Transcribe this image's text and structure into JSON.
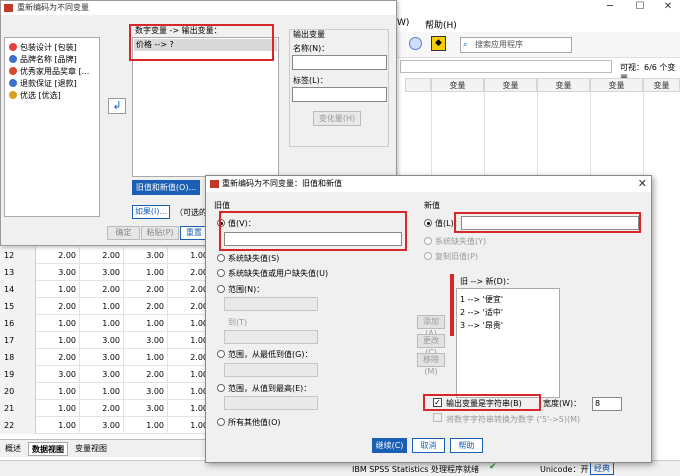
{
  "bg": {
    "menu": [
      "W)",
      "帮助(H)"
    ],
    "search_placeholder": "搜索应用程序",
    "visible": "可视：6/6 个变量",
    "col_header": "变量",
    "rows": [
      {
        "n": "12",
        "c": [
          "2.00",
          "2.00",
          "3.00",
          "1.00"
        ]
      },
      {
        "n": "13",
        "c": [
          "3.00",
          "3.00",
          "1.00",
          "2.00"
        ]
      },
      {
        "n": "14",
        "c": [
          "1.00",
          "2.00",
          "2.00",
          "2.00"
        ]
      },
      {
        "n": "15",
        "c": [
          "2.00",
          "1.00",
          "2.00",
          "2.00"
        ]
      },
      {
        "n": "16",
        "c": [
          "1.00",
          "1.00",
          "1.00",
          "1.00"
        ]
      },
      {
        "n": "17",
        "c": [
          "1.00",
          "3.00",
          "3.00",
          "1.00"
        ]
      },
      {
        "n": "18",
        "c": [
          "2.00",
          "3.00",
          "1.00",
          "2.00"
        ]
      },
      {
        "n": "19",
        "c": [
          "3.00",
          "3.00",
          "2.00",
          "1.00"
        ]
      },
      {
        "n": "20",
        "c": [
          "1.00",
          "1.00",
          "3.00",
          "1.00"
        ]
      },
      {
        "n": "21",
        "c": [
          "1.00",
          "2.00",
          "3.00",
          "1.00"
        ]
      },
      {
        "n": "22",
        "c": [
          "1.00",
          "3.00",
          "1.00",
          "1.00"
        ]
      }
    ],
    "tabs": [
      "概述",
      "数据视图",
      "变量视图"
    ],
    "status_center": "IBM SPSS Statistics 处理程序就绪",
    "status_right": "Unicode：开",
    "status_mode": "经典"
  },
  "dlg1": {
    "title": "重新编码为不同变量",
    "vars": [
      {
        "label": "包装设计 [包装]",
        "color": "#e04040"
      },
      {
        "label": "品牌名称 [品牌]",
        "color": "#3b6fd1"
      },
      {
        "label": "优秀家用品奖章 [...",
        "color": "#d94a2f"
      },
      {
        "label": "退款保证 [退款]",
        "color": "#3b6fd1"
      },
      {
        "label": "优选 [优选]",
        "color": "#d9a020"
      }
    ],
    "numvar_label": "数字变量 -> 输出变量：",
    "numvar_item": "价格 --> ?",
    "out_group": "输出变量",
    "name_label": "名称(N)：",
    "label_label": "标签(L)：",
    "change_btn": "变化量(H)",
    "oldnew_btn": "旧值和新值(O)...",
    "if_btn": "如果(I)...",
    "if_hint": "（可选的",
    "ok_btn": "确定",
    "paste_btn": "粘贴(P)",
    "reset_btn": "重置(R)"
  },
  "dlg2": {
    "title": "重新编码为不同变量：旧值和新值",
    "old_title": "旧值",
    "value_opt": "值(V)：",
    "sysmis_opt": "系统缺失值(S)",
    "sysusermis_opt": "系统缺失值或用户缺失值(U)",
    "range_opt": "范围(N)：",
    "to_label": "到(T)",
    "range_low_opt": "范围，从最低到值(G)：",
    "range_high_opt": "范围，从值到最高(E)：",
    "else_opt": "所有其他值(O)",
    "new_title": "新值",
    "new_value_opt": "值(L)：",
    "new_sysmis": "系统缺失值(Y)",
    "copy_old": "复制旧值(P)",
    "map_title": "旧 --> 新(D)：",
    "mappings": [
      "1 --> '便宜'",
      "2 --> '适中'",
      "3 --> '昂贵'"
    ],
    "add_btn": "添加(A)",
    "change_btn": "更改(C)",
    "remove_btn": "移除(M)",
    "outstring": "输出变量是字符串(B)",
    "width_label": "宽度(W)：",
    "width_value": "8",
    "numconv": "将数字字符串转换为数字 ('5'->5)(M)",
    "continue_btn": "继续(C)",
    "cancel_btn": "取消",
    "help_btn": "帮助"
  }
}
